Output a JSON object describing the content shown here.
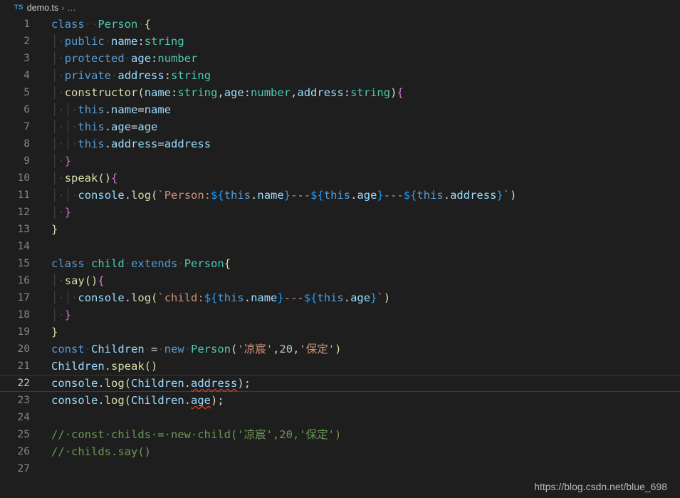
{
  "breadcrumb": {
    "file_icon_label": "TS",
    "file_name": "demo.ts",
    "separator": "›",
    "overflow": "…"
  },
  "editor": {
    "language": "typescript",
    "current_line": 22,
    "total_lines": 27,
    "line_numbers": [
      "1",
      "2",
      "3",
      "4",
      "5",
      "6",
      "7",
      "8",
      "9",
      "10",
      "11",
      "12",
      "13",
      "14",
      "15",
      "16",
      "17",
      "18",
      "19",
      "20",
      "21",
      "22",
      "23",
      "24",
      "25",
      "26",
      "27"
    ],
    "lines": [
      {
        "n": "1",
        "text": "class  Person {"
      },
      {
        "n": "2",
        "text": "  public name:string"
      },
      {
        "n": "3",
        "text": "  protected age:number"
      },
      {
        "n": "4",
        "text": "  private address:string"
      },
      {
        "n": "5",
        "text": "  constructor(name:string,age:number,address:string){"
      },
      {
        "n": "6",
        "text": "    this.name=name"
      },
      {
        "n": "7",
        "text": "    this.age=age"
      },
      {
        "n": "8",
        "text": "    this.address=address"
      },
      {
        "n": "9",
        "text": "  }"
      },
      {
        "n": "10",
        "text": "  speak(){"
      },
      {
        "n": "11",
        "text": "    console.log(`Person:${this.name}---${this.age}---${this.address}`)"
      },
      {
        "n": "12",
        "text": "  }"
      },
      {
        "n": "13",
        "text": "}"
      },
      {
        "n": "14",
        "text": ""
      },
      {
        "n": "15",
        "text": "class child extends Person{"
      },
      {
        "n": "16",
        "text": "  say(){"
      },
      {
        "n": "17",
        "text": "    console.log(`child:${this.name}---${this.age}`)"
      },
      {
        "n": "18",
        "text": "  }"
      },
      {
        "n": "19",
        "text": "}"
      },
      {
        "n": "20",
        "text": "const Children = new Person('凉宸',20,'保定')"
      },
      {
        "n": "21",
        "text": "Children.speak()"
      },
      {
        "n": "22",
        "text": "console.log(Children.address);"
      },
      {
        "n": "23",
        "text": "console.log(Children.age);"
      },
      {
        "n": "24",
        "text": ""
      },
      {
        "n": "25",
        "text": "// const childs = new child('凉宸',20,'保定')"
      },
      {
        "n": "26",
        "text": "// childs.say()"
      },
      {
        "n": "27",
        "text": ""
      }
    ],
    "errors": [
      {
        "line": "22",
        "token": "address"
      },
      {
        "line": "23",
        "token": "age"
      }
    ]
  },
  "watermark": {
    "text": "https://blog.csdn.net/blue_698"
  },
  "colors": {
    "background": "#1e1e1e",
    "keyword": "#569cd6",
    "type": "#4ec9b0",
    "variable": "#9cdcfe",
    "function": "#dcdcaa",
    "string": "#ce9178",
    "number": "#b5cea8",
    "comment": "#6a9955",
    "punctuation": "#d4d4d4",
    "line_number": "#858585",
    "error_squiggle": "#c0392b"
  }
}
